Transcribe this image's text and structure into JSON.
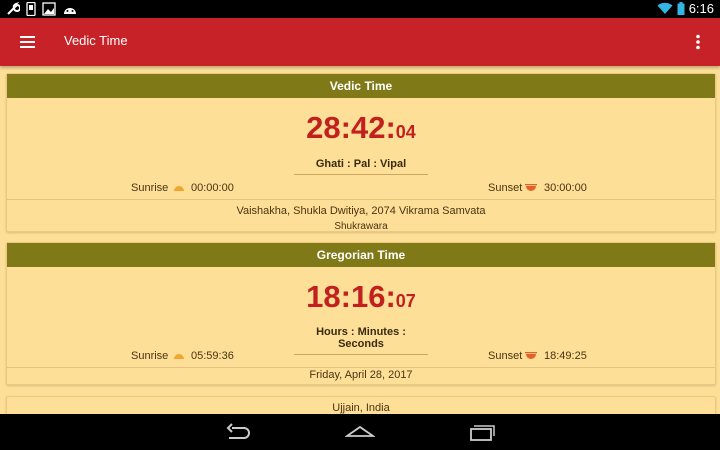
{
  "status_bar": {
    "time": "6:16",
    "icons": [
      "wrench-icon",
      "phone-icon",
      "image-icon",
      "android-icon",
      "wifi-icon",
      "battery-icon"
    ]
  },
  "app_bar": {
    "title": "Vedic Time",
    "menu_icon": "hamburger-menu-icon",
    "overflow_icon": "more-vert-icon"
  },
  "vedic_card": {
    "header": "Vedic Time",
    "time_main": "28:42:",
    "time_seconds": "04",
    "units_label": "Ghati : Pal : Vipal",
    "sunrise_label": "Sunrise",
    "sunrise_value": "00:00:00",
    "sunset_label": "Sunset",
    "sunset_value": "30:00:00",
    "date_line": "Vaishakha, Shukla Dwitiya, 2074 Vikrama Samvata",
    "day_name": "Shukrawara"
  },
  "gregorian_card": {
    "header": "Gregorian Time",
    "time_main": "18:16:",
    "time_seconds": "07",
    "units_label": "Hours : Minutes : Seconds",
    "sunrise_label": "Sunrise",
    "sunrise_value": "05:59:36",
    "sunset_label": "Sunset",
    "sunset_value": "18:49:25",
    "date_line": "Friday, April 28, 2017"
  },
  "location_card": {
    "location": "Ujjain, India"
  },
  "nav_bar": {
    "back_icon": "back-icon",
    "home_icon": "home-icon",
    "recents_icon": "recents-icon"
  },
  "colors": {
    "app_bar": "#c62227",
    "card_header": "#7f7a17",
    "background": "#fddf98",
    "time_text": "#c21f1f",
    "sunrise_icon": "#f2a531",
    "sunset_icon": "#e0632a"
  }
}
